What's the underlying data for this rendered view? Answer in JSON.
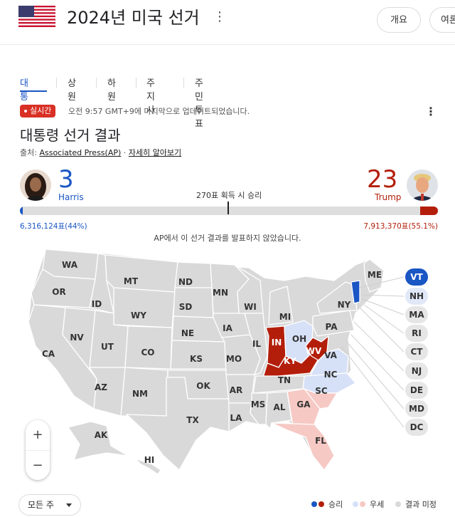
{
  "header": {
    "title": "2024년 미국 선거",
    "overview_label": "개요",
    "polls_label": "여론"
  },
  "tabs": [
    {
      "label": "대통령",
      "active": true
    },
    {
      "label": "상원"
    },
    {
      "label": "하원"
    },
    {
      "label": "주지사"
    },
    {
      "label": "주민투표"
    }
  ],
  "status": {
    "live_label": "실시간",
    "updated_text": "오전 9:57 GMT+9에 마지막으로 업데이트되었습니다."
  },
  "section": {
    "title": "대통령 선거 결과",
    "source_prefix": "출처: ",
    "source_link": "Associated Press(AP)",
    "source_sep": " · ",
    "learn_more": "자세히 알아보기"
  },
  "candidates": {
    "dem": {
      "name": "Harris",
      "electoral_votes": "3",
      "popular_votes": "6,316,124표(44%)",
      "color": "#1a56c4"
    },
    "rep": {
      "name": "Trump",
      "electoral_votes": "23",
      "popular_votes": "7,913,370표(55.1%)",
      "color": "#b31e0b"
    }
  },
  "progress": {
    "threshold_label": "270표 획득 시 승리",
    "dem_fraction": 0.0056,
    "rep_fraction": 0.0427,
    "threshold_fraction": 0.5019
  },
  "ap_note": "AP에서 이 선거 결과를 발표하지 않았습니다.",
  "colors": {
    "dem_win": "#1a56c4",
    "rep_win": "#b31e0b",
    "dem_lean": "#d6e0f7",
    "rep_lean": "#f6c9c4",
    "undecided": "#d9d9d9"
  },
  "states": [
    "WA",
    "OR",
    "CA",
    "ID",
    "NV",
    "MT",
    "WY",
    "UT",
    "AZ",
    "CO",
    "NM",
    "ND",
    "SD",
    "NE",
    "KS",
    "OK",
    "TX",
    "MN",
    "IA",
    "MO",
    "AR",
    "LA",
    "WI",
    "IL",
    "MI",
    "IN",
    "OH",
    "KY",
    "TN",
    "MS",
    "AL",
    "GA",
    "FL",
    "SC",
    "NC",
    "VA",
    "WV",
    "PA",
    "NY",
    "ME",
    "AK",
    "HI"
  ],
  "east_states": [
    "VT",
    "NH",
    "MA",
    "RI",
    "CT",
    "NJ",
    "DE",
    "MD",
    "DC"
  ],
  "zoom": {
    "in": "+",
    "out": "−"
  },
  "filter": {
    "selected": "모든 주"
  },
  "legend": {
    "win": "승리",
    "lean": "우세",
    "undecided": "결과 미정"
  }
}
